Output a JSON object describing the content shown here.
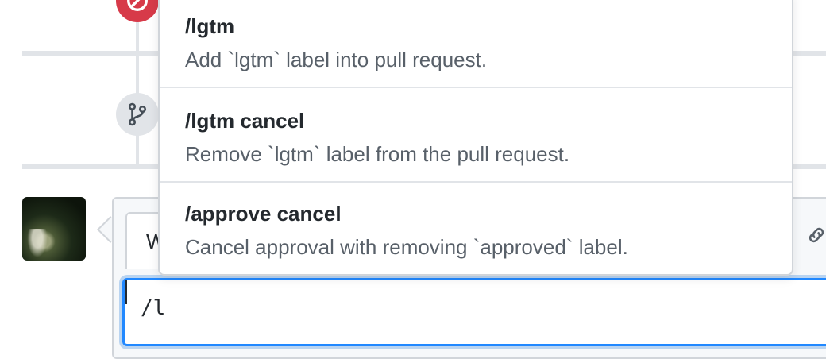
{
  "suggestions": [
    {
      "command": "/lgtm",
      "description": "Add `lgtm` label into pull request."
    },
    {
      "command": "/lgtm cancel",
      "description": "Remove `lgtm` label from the pull request."
    },
    {
      "command": "/approve cancel",
      "description": "Cancel approval with removing `approved` label."
    }
  ],
  "comment": {
    "write_tab_label": "W",
    "input_value": "/l"
  },
  "icons": {
    "closed_event": "circle-slash-icon",
    "branch_event": "git-branch-icon",
    "link": "link-icon"
  },
  "colors": {
    "closed_red": "#d73a49",
    "focus_blue": "#2188ff",
    "muted_text": "#586069"
  }
}
